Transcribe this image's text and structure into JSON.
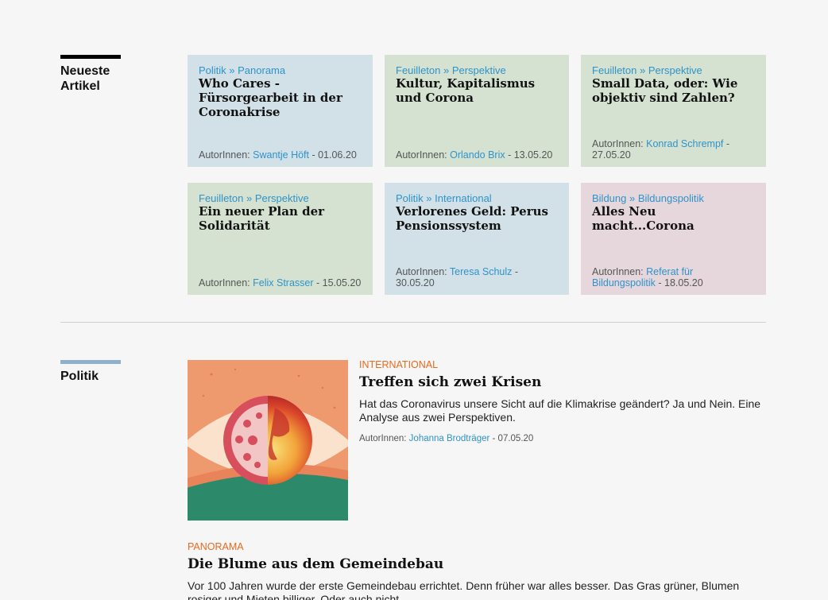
{
  "sections": {
    "newest": {
      "label": "Neueste\nArtikel",
      "bar_color": "#000000"
    },
    "politics": {
      "label": "Politik",
      "bar_color": "#8fb1cc"
    }
  },
  "author_prefix": "AutorInnen:",
  "cards": [
    {
      "category": "Politik » Panorama",
      "title": "Who Cares - Fürsorgearbeit in der Coronakrise",
      "author": "Swantje Höft",
      "date": " - 01.06.20",
      "bg": "#d2e0e8"
    },
    {
      "category": "Feuilleton » Perspektive",
      "title": "Kultur, Kapitalismus und Corona",
      "author": "Orlando Brix",
      "date": " - 13.05.20",
      "bg": "#d5e2d1"
    },
    {
      "category": "Feuilleton » Perspektive",
      "title": "Small Data, oder: Wie objektiv sind Zahlen?",
      "author": "Konrad Schrempf",
      "date": " - 27.05.20",
      "bg": "#d5e2d1"
    },
    {
      "category": "Feuilleton » Perspektive",
      "title": "Ein neuer Plan der Solidarität",
      "author": "Felix Strasser",
      "date": " - 15.05.20",
      "bg": "#d5e2d1"
    },
    {
      "category": "Politik » International",
      "title": "Verlorenes Geld: Perus Pensionssystem",
      "author": "Teresa Schulz",
      "date": " - 30.05.20",
      "bg": "#d2e0e8"
    },
    {
      "category": "Bildung » Bildungspolitik",
      "title": "Alles Neu macht...Corona",
      "author": "Referat für Bildungspolitik",
      "date": " - 18.05.20",
      "bg": "#e6d7dd"
    }
  ],
  "featured": {
    "kicker": "INTERNATIONAL",
    "headline": "Treffen sich zwei Krisen",
    "teaser": "Hat das Coronavirus unsere Sicht auf die Klimakrise geändert? Ja und Nein. Eine Analyse aus zwei Perspektiven.",
    "author": "Johanna Brodträger",
    "date": " - 07.05.20"
  },
  "second": {
    "kicker": "PANORAMA",
    "headline": "Die Blume aus dem Gemeindebau",
    "teaser": "Vor 100 Jahren wurde der erste Gemeindebau errichtet. Denn früher war alles besser. Das Gras grüner, Blumen rosiger und Mieten billiger. Oder auch nicht."
  }
}
